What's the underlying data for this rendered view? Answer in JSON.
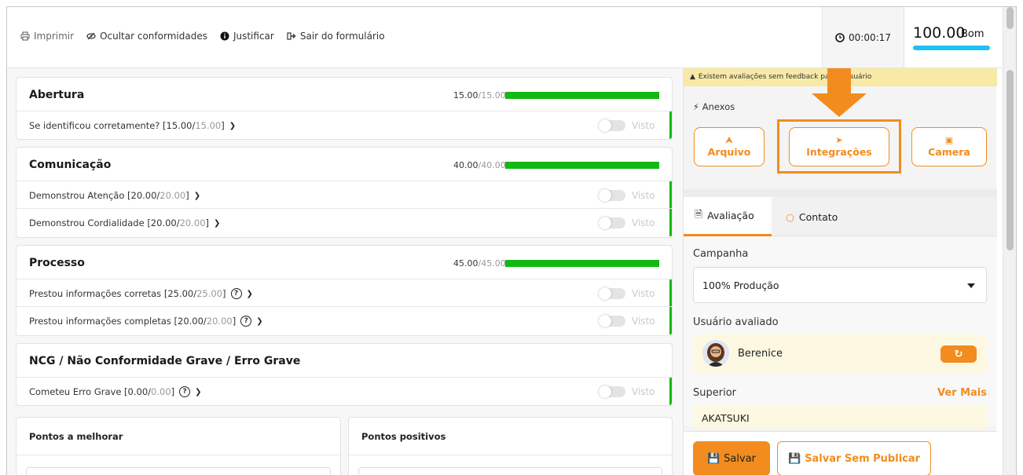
{
  "toolbar": {
    "print_label": "Imprimir",
    "hide_label": "Ocultar conformidades",
    "justify_label": "Justificar",
    "exit_label": "Sair do formulário"
  },
  "timer": {
    "value": "00:00:17"
  },
  "score": {
    "value": "100.00",
    "label": "Bom",
    "bar_color": "#1ec1f2"
  },
  "sections": [
    {
      "title": "Abertura",
      "score": "15.00",
      "max": "15.00",
      "items": [
        {
          "label": "Se identificou corretamente? [15.00/",
          "max": "15.00",
          "close": "]",
          "help": false,
          "toggle_label": "Visto"
        }
      ]
    },
    {
      "title": "Comunicação",
      "score": "40.00",
      "max": "40.00",
      "items": [
        {
          "label": "Demonstrou Atenção [20.00/",
          "max": "20.00",
          "close": "]",
          "help": false,
          "toggle_label": "Visto"
        },
        {
          "label": "Demonstrou Cordialidade [20.00/",
          "max": "20.00",
          "close": "]",
          "help": false,
          "toggle_label": "Visto"
        }
      ]
    },
    {
      "title": "Processo",
      "score": "45.00",
      "max": "45.00",
      "items": [
        {
          "label": "Prestou informações corretas [25.00/",
          "max": "25.00",
          "close": "]",
          "help": true,
          "toggle_label": "Visto"
        },
        {
          "label": "Prestou informações completas [20.00/",
          "max": "20.00",
          "close": "]",
          "help": true,
          "toggle_label": "Visto"
        }
      ]
    },
    {
      "title": "NCG / Não Conformidade Grave / Erro Grave",
      "score": "",
      "max": "",
      "items": [
        {
          "label": "Cometeu Erro Grave [0.00/",
          "max": "0.00",
          "close": "]",
          "help": true,
          "toggle_label": "Visto"
        }
      ]
    }
  ],
  "notes": {
    "improve_title": "Pontos a melhorar",
    "positive_title": "Pontos positivos"
  },
  "right": {
    "warning": "Existem avaliações sem feedback para o usuário",
    "anexos_title": "Anexos",
    "attach_buttons": [
      "Arquivo",
      "Integrações",
      "Camera"
    ],
    "tabs": [
      "Avaliação",
      "Contato"
    ],
    "campanha_label": "Campanha",
    "campanha_value": "100% Produção",
    "usuario_label": "Usuário avaliado",
    "usuario_name": "Berenice",
    "superior_label": "Superior",
    "ver_mais": "Ver Mais",
    "superior_value": "AKATSUKI",
    "save_label": "Salvar",
    "save_np_label": "Salvar Sem Publicar",
    "accent_color": "#f28c1e",
    "success_color": "#14b814"
  }
}
